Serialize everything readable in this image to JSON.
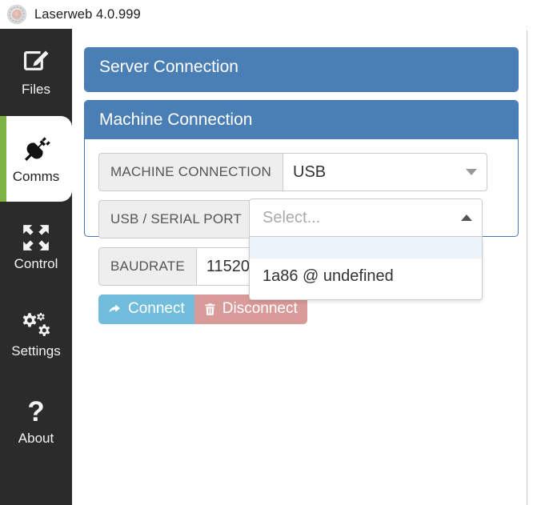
{
  "titlebar": {
    "app_title": "Laserweb 4.0.999",
    "logo_icon": "gear-logo-icon"
  },
  "sidebar": {
    "items": [
      {
        "label": "Files",
        "icon": "edit-square-icon",
        "active": false
      },
      {
        "label": "Comms",
        "icon": "plug-icon",
        "active": true
      },
      {
        "label": "Control",
        "icon": "arrows-expand-icon",
        "active": false
      },
      {
        "label": "Settings",
        "icon": "gears-icon",
        "active": false
      },
      {
        "label": "About",
        "icon": "question-mark-icon",
        "active": false
      }
    ],
    "accent_color": "#7cb342",
    "background_color": "#2b2b2b"
  },
  "panels": {
    "server_connection": {
      "title": "Server Connection"
    },
    "machine_connection": {
      "title": "Machine Connection",
      "header_color": "#4a7fb5",
      "rows": {
        "machine_connection": {
          "label": "MACHINE CONNECTION",
          "value": "USB",
          "caret_icon": "chevron-down-icon"
        },
        "usb_serial_port": {
          "label": "USB / SERIAL PORT",
          "placeholder": "Select...",
          "caret_icon": "chevron-up-icon",
          "options": [
            "",
            "1a86 @ undefined"
          ]
        },
        "baudrate": {
          "label": "BAUDRATE",
          "value": "11520"
        }
      },
      "buttons": {
        "connect": {
          "label": "Connect",
          "icon": "arrow-forward-icon",
          "color": "#72bcdc"
        },
        "disconnect": {
          "label": "Disconnect",
          "icon": "trash-icon",
          "color": "#d99a9a"
        }
      }
    }
  }
}
